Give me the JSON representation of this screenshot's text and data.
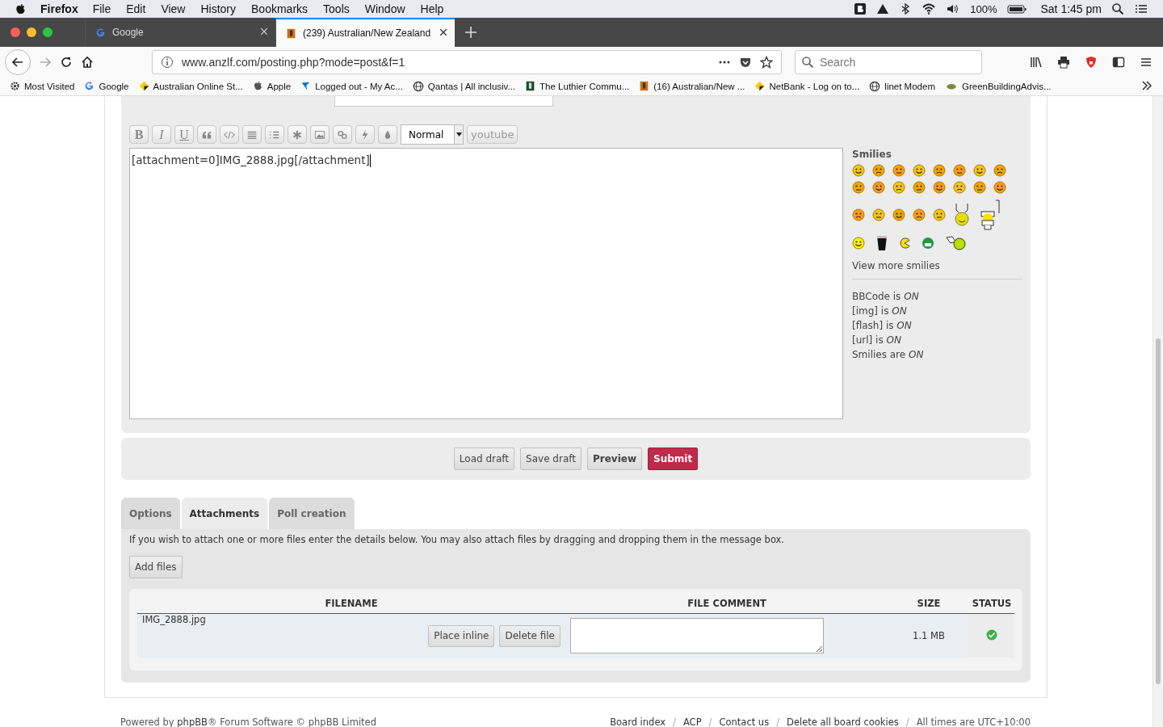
{
  "menubar": {
    "app": "Firefox",
    "menus": [
      "File",
      "Edit",
      "View",
      "History",
      "Bookmarks",
      "Tools",
      "Window",
      "Help"
    ],
    "battery": "100%",
    "clock": "Sat 1:45 pm"
  },
  "tabs": [
    {
      "label": "Google",
      "selected": false
    },
    {
      "label": "(239) Australian/New Zealand",
      "selected": true
    }
  ],
  "address_bar": {
    "url": "www.anzlf.com/posting.php?mode=post&f=1"
  },
  "search": {
    "placeholder": "Search"
  },
  "bookmarks": [
    "Most Visited",
    "Google",
    "Australian Online St...",
    "Apple",
    "Logged out - My Ac...",
    "Qantas | All inclusiv...",
    "The Luthier Commu...",
    "(16) Australian/New ...",
    "NetBank - Log on to...",
    "linet Modem",
    "GreenBuildingAdvis..."
  ],
  "editor": {
    "letter_buttons": [
      "B",
      "I",
      "U"
    ],
    "format_select": "Normal",
    "youtube_button": "youtube",
    "message": "[attachment=0]IMG_2888.jpg[/attachment]"
  },
  "smilies": {
    "title": "Smilies",
    "more_link": "View more smilies",
    "status_lines": [
      "BBCode is *ON*",
      "[img] is *ON*",
      "[flash] is *ON*",
      "[url] is *ON*",
      "Smilies are *ON*"
    ]
  },
  "actions": [
    {
      "label": "Load draft",
      "kind": "plain"
    },
    {
      "label": "Save draft",
      "kind": "plain"
    },
    {
      "label": "Preview",
      "kind": "bold"
    },
    {
      "label": "Submit",
      "kind": "primary"
    }
  ],
  "panel_tabs": [
    {
      "label": "Options",
      "selected": false
    },
    {
      "label": "Attachments",
      "selected": true
    },
    {
      "label": "Poll creation",
      "selected": false
    }
  ],
  "attachments": {
    "hint": "If you wish to attach one or more files enter the details below. You may also attach files by dragging and dropping them in the message box.",
    "add_button": "Add files",
    "columns": [
      "FILENAME",
      "FILE COMMENT",
      "SIZE",
      "STATUS"
    ],
    "rows": [
      {
        "filename": "IMG_2888.jpg",
        "place_inline": "Place inline",
        "delete": "Delete file",
        "size": "1.1 MB"
      }
    ]
  },
  "footer": {
    "powered_by": "Powered by **phpBB**® Forum Software © phpBB Limited",
    "links": [
      "Board index",
      "ACP",
      "Contact us",
      "Delete all board cookies"
    ],
    "separator": "/",
    "timezone": "All times are UTC+10:00"
  }
}
